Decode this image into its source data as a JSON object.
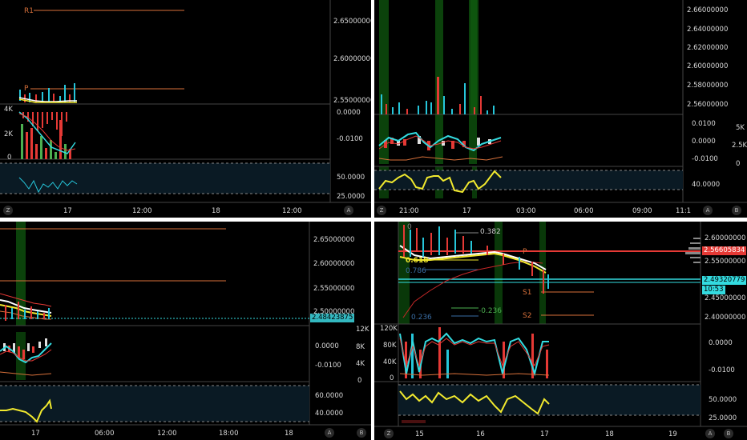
{
  "colors": {
    "background": "#000000",
    "up": "#26c6da",
    "down": "#e53935",
    "yellow": "#f2ea2e",
    "orange": "#d7703a",
    "green_band": "#0f5e0f",
    "price_red": "#e53935",
    "price_cyan": "#33dbe0"
  },
  "buttons": {
    "z": "Z",
    "a": "A",
    "b": "B"
  },
  "panel_tl": {
    "price_axis": [
      "2.65000000",
      "2.60000000",
      "2.55000000"
    ],
    "vol_axis_left": [
      "4K",
      "2K",
      "0"
    ],
    "macd_axis": [
      "0.0000",
      "-0.0100"
    ],
    "rsi_axis": [
      "50.0000",
      "25.0000"
    ],
    "time_axis": [
      "17",
      "12:00",
      "18",
      "12:00"
    ],
    "pivot_labels": {
      "r1": "R1",
      "p": "P"
    }
  },
  "panel_tr": {
    "price_axis": [
      "2.66000000",
      "2.64000000",
      "2.62000000",
      "2.60000000",
      "2.58000000",
      "2.56000000"
    ],
    "macd_axis": [
      "0.0100",
      "0.0000",
      "-0.0100"
    ],
    "vol_axis_right": [
      "5K",
      "2.5K",
      "0"
    ],
    "rsi_axis": [
      "40.0000"
    ],
    "time_axis": [
      "21:00",
      "17",
      "03:00",
      "06:00",
      "09:00",
      "11:1"
    ]
  },
  "panel_bl": {
    "price_axis": [
      "2.65000000",
      "2.60000000",
      "2.55000000",
      "2.50000000"
    ],
    "price_tag": "2.48423875",
    "macd_axis": [
      "0.0000",
      "-0.0100"
    ],
    "vol_axis_right": [
      "12K",
      "8K",
      "4K",
      "0"
    ],
    "rsi_axis": [
      "60.0000",
      "40.0000"
    ],
    "time_axis": [
      "17",
      "06:00",
      "12:00",
      "18:00",
      "18"
    ]
  },
  "panel_br": {
    "price_axis": [
      "2.60000000",
      "2.55000000",
      "2.45000000",
      "2.40000000"
    ],
    "price_tag_red": "2.56605834",
    "price_tag_cyan": "2.49320779",
    "countdown": "10:53",
    "vol_axis_left": [
      "120K",
      "80K",
      "40K",
      "0"
    ],
    "macd_axis": [
      "0.0000",
      "-0.0100"
    ],
    "rsi_axis": [
      "50.0000",
      "25.0000"
    ],
    "time_axis": [
      "15",
      "16",
      "17",
      "18",
      "19"
    ],
    "fib_labels": {
      "f382": "0.382",
      "f618": "0.618",
      "f786": "0.786",
      "fneg": "-0.236",
      "f0": "0",
      "f236": "0.236"
    },
    "pivot_labels": {
      "s1": "S1",
      "s2": "S2",
      "p": "P"
    }
  }
}
